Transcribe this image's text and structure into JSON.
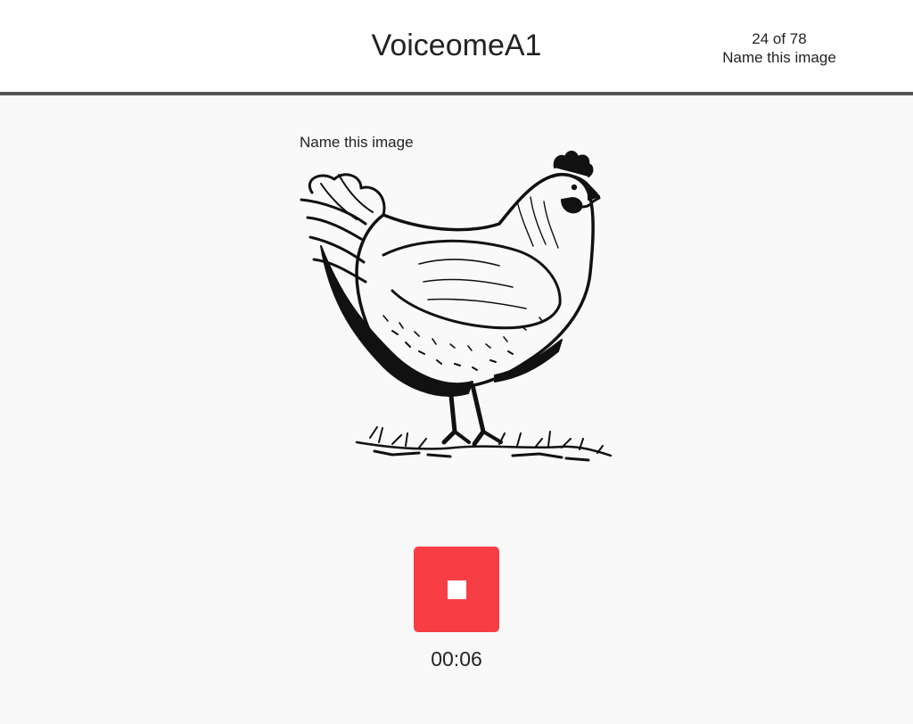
{
  "header": {
    "title": "VoiceomeA1",
    "progress": {
      "counter": "24 of 78",
      "task_name": "Name this image"
    }
  },
  "task": {
    "prompt": "Name this image",
    "stimulus_icon": "hen-drawing"
  },
  "recorder": {
    "button_icon": "stop-icon",
    "button_color": "#f73e45",
    "elapsed": "00:06"
  }
}
